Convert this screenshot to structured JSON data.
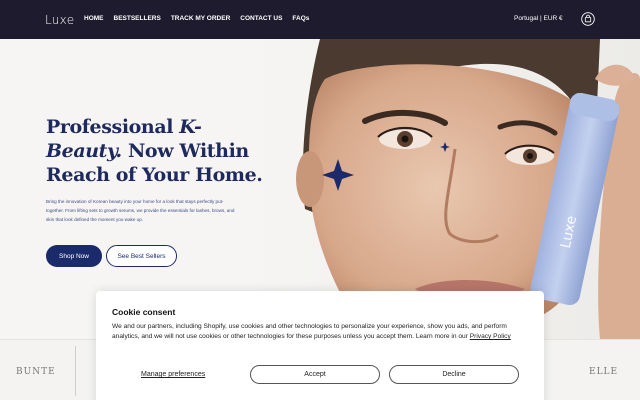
{
  "brand": {
    "logo": "Luxe"
  },
  "nav": {
    "items": [
      "HOME",
      "BESTSELLERS",
      "TRACK MY ORDER",
      "CONTACT US",
      "FAQs"
    ]
  },
  "header": {
    "locale": "Portugal | EUR €",
    "cart_icon": "shopping-bag-icon"
  },
  "hero": {
    "title_part1": "Professional ",
    "title_part2": "K-Beauty.",
    "title_part3": "Now Within Reach of Your Home.",
    "description": "Bring the innovation of Korean beauty into your home for a look that stays perfectly put-together. From lifting sets to growth serums, we provide the essentials for lashes, brows, and skin that look defined the moment you wake up.",
    "primary_cta": "Shop Now",
    "secondary_cta": "See Best Sellers",
    "product_label": "Luxe",
    "colors": {
      "accent": "#1b2a6b",
      "header": "#1e1b2e",
      "product": "#b9c8ea"
    }
  },
  "press": {
    "left_logo": "BUNTE",
    "right_logo": "ELLE"
  },
  "cookie": {
    "title": "Cookie consent",
    "body": "We and our partners, including Shopify, use cookies and other technologies to personalize your experience, show you ads, and perform analytics, and we will not use cookies or other technologies for these purposes unless you accept them. Learn more in our ",
    "link": "Privacy Policy",
    "manage": "Manage preferences",
    "accept": "Accept",
    "decline": "Decline"
  }
}
